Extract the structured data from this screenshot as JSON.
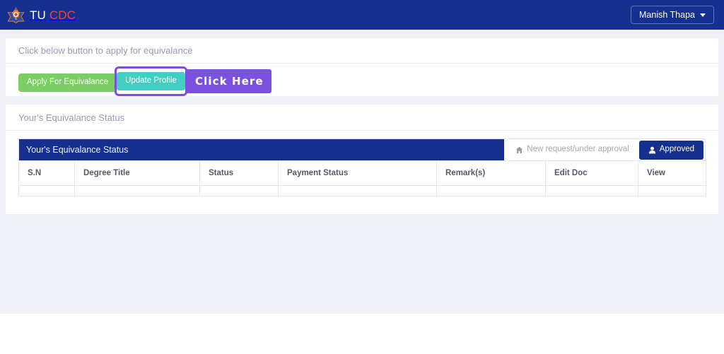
{
  "navbar": {
    "logo_icon": "tu-star-logo-icon",
    "brand_tu": "TU",
    "brand_cdc": "CDC",
    "user": {
      "name": "Manish Thapa",
      "caret_icon": "chevron-down-icon"
    }
  },
  "apply_card": {
    "instruction": "Click below button to apply for equivalance",
    "buttons": {
      "apply": "Apply For Equivalance",
      "update_profile": "Update Profile"
    },
    "annotation": {
      "label": "Click Here",
      "ring_color": "#7b4ee0",
      "badge_color": "#7b52e0"
    }
  },
  "status_card": {
    "heading": "Your's Equivalance Status",
    "bar_title": "Your's Equivalance Status",
    "tabs": [
      {
        "label": "New request/under approval",
        "icon": "home-icon",
        "active": false
      },
      {
        "label": "Approved",
        "icon": "user-icon",
        "active": true
      }
    ],
    "table": {
      "columns": [
        "S.N",
        "Degree Title",
        "Status",
        "Payment Status",
        "Remark(s)",
        "Edit Doc",
        "View"
      ],
      "rows": []
    }
  },
  "colors": {
    "navy": "#15308f",
    "green": "#7ace63",
    "teal": "#41cfc4",
    "purple": "#7b52e0",
    "red": "#e8463b",
    "page_bg": "#f0f1f6"
  }
}
